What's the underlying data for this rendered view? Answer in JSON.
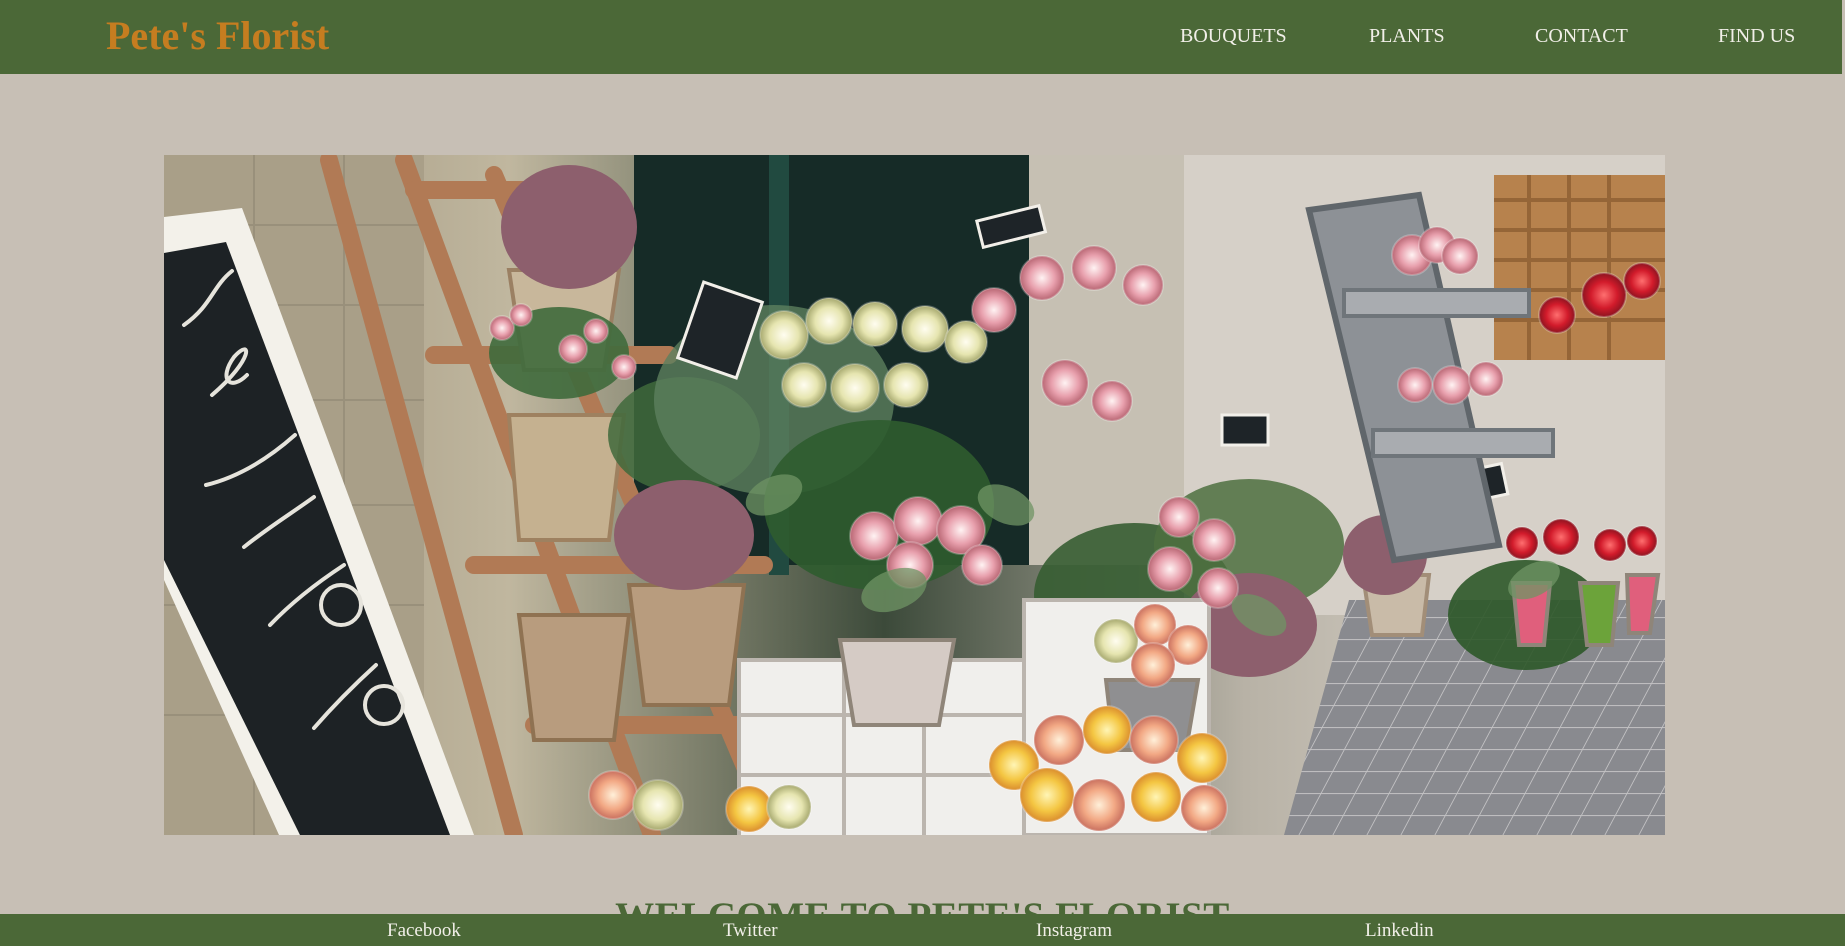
{
  "header": {
    "brand": "Pete's Florist",
    "nav": [
      "BOUQUETS",
      "PLANTS",
      "CONTACT",
      "FIND US"
    ]
  },
  "hero": {
    "icon": "storefront-flowers-image"
  },
  "main": {
    "heading": "WELCOME TO PETE'S FLORIST"
  },
  "footer": {
    "links": [
      "Facebook",
      "Twitter",
      "Instagram",
      "Linkedin"
    ]
  },
  "colors": {
    "header_bg": "#4b6837",
    "page_bg": "#c7bfb5",
    "brand": "#c57d20",
    "nav_text": "#f1efe8"
  }
}
